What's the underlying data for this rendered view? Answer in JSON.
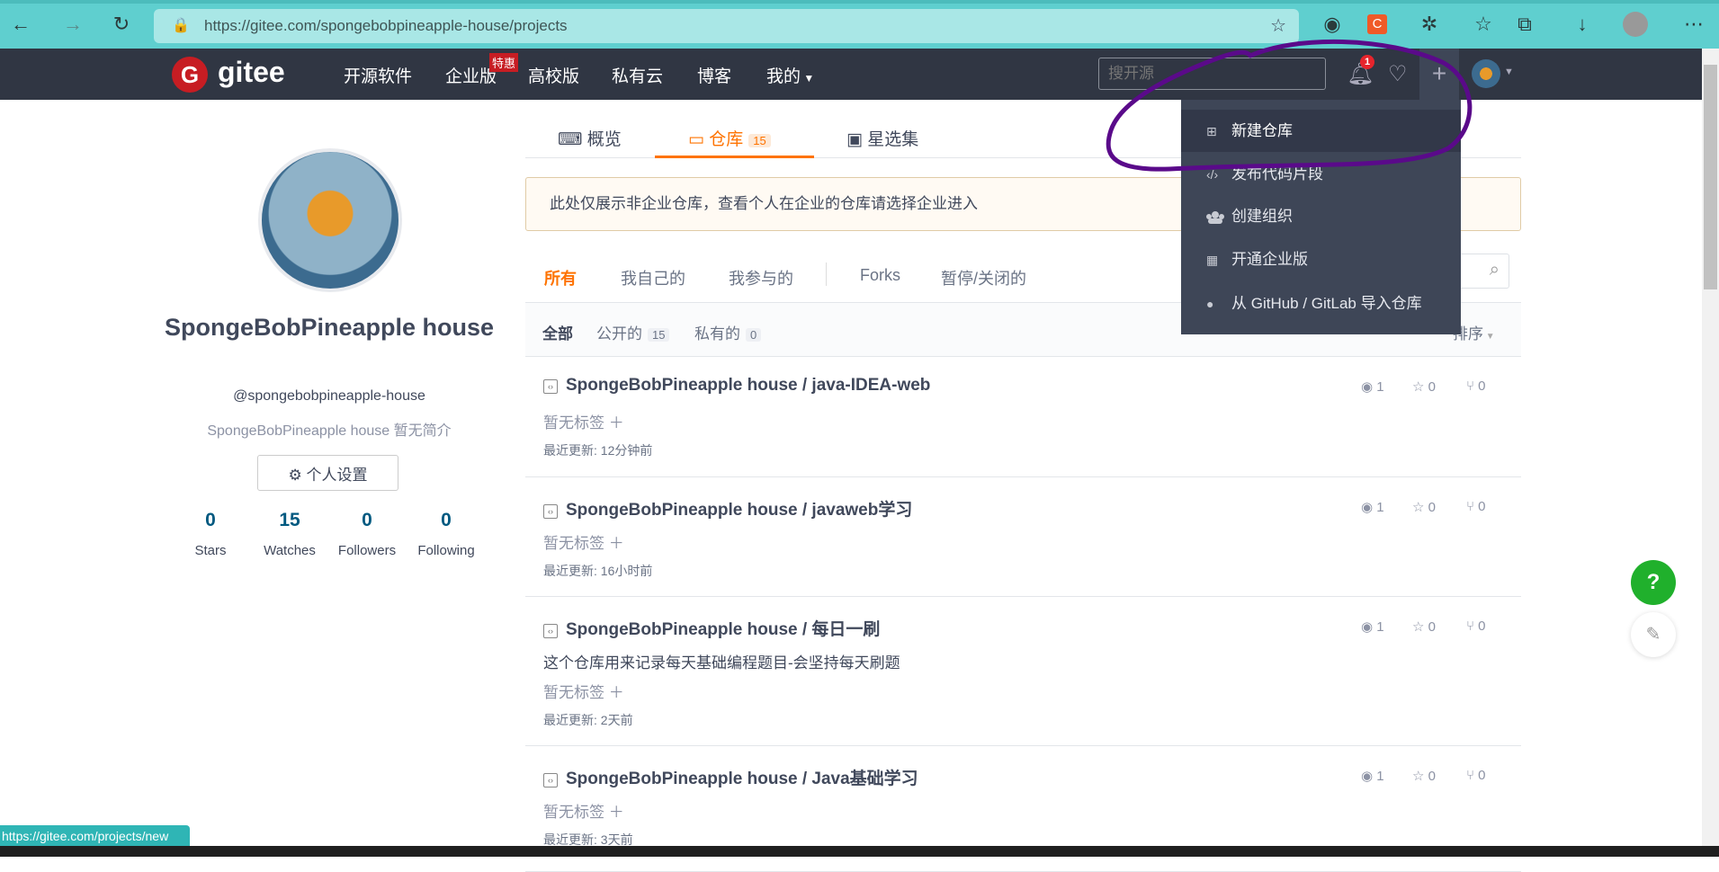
{
  "browser": {
    "url": "https://gitee.com/spongebobpineapple-house/projects",
    "status_link": "https://gitee.com/projects/new"
  },
  "nav": {
    "logo": "gitee",
    "items": [
      "开源软件",
      "企业版",
      "高校版",
      "私有云",
      "博客",
      "我的"
    ],
    "badge": "特惠",
    "search_placeholder": "搜开源",
    "notification_count": "1"
  },
  "dropdown": {
    "items": [
      {
        "label": "新建仓库",
        "icon": "plus-square-icon"
      },
      {
        "label": "发布代码片段",
        "icon": "code-icon"
      },
      {
        "label": "创建组织",
        "icon": "group-icon"
      },
      {
        "label": "开通企业版",
        "icon": "building-icon"
      },
      {
        "label": "从 GitHub / GitLab 导入仓库",
        "icon": "github-icon"
      }
    ]
  },
  "profile": {
    "name": "SpongeBobPineapple house",
    "handle": "@spongebobpineapple-house",
    "bio": "SpongeBobPineapple house 暂无简介",
    "settings": "个人设置",
    "stats": [
      {
        "n": "0",
        "l": "Stars"
      },
      {
        "n": "15",
        "l": "Watches"
      },
      {
        "n": "0",
        "l": "Followers"
      },
      {
        "n": "0",
        "l": "Following"
      }
    ]
  },
  "tabs": [
    {
      "label": "概览"
    },
    {
      "label": "仓库",
      "count": "15"
    },
    {
      "label": "星选集"
    }
  ],
  "notice": "此处仅展示非企业仓库，查看个人在企业的仓库请选择企业进入",
  "filters": [
    "所有",
    "我自己的",
    "我参与的",
    "Forks",
    "暂停/关闭的"
  ],
  "subfilters": [
    {
      "label": "全部"
    },
    {
      "label": "公开的",
      "count": "15"
    },
    {
      "label": "私有的",
      "count": "0"
    }
  ],
  "sort": "排序",
  "repos": [
    {
      "title": "SpongeBobPineapple house / java-IDEA-web",
      "desc": "",
      "tags": "暂无标签 ＋",
      "updated": "最近更新: 12分钟前",
      "watch": "1",
      "star": "0",
      "fork": "0"
    },
    {
      "title": "SpongeBobPineapple house / javaweb学习",
      "desc": "",
      "tags": "暂无标签 ＋",
      "updated": "最近更新: 16小时前",
      "watch": "1",
      "star": "0",
      "fork": "0"
    },
    {
      "title": "SpongeBobPineapple house / 每日一刷",
      "desc": "这个仓库用来记录每天基础编程题目-会坚持每天刷题",
      "tags": "暂无标签 ＋",
      "updated": "最近更新: 2天前",
      "watch": "1",
      "star": "0",
      "fork": "0"
    },
    {
      "title": "SpongeBobPineapple house / Java基础学习",
      "desc": "",
      "tags": "暂无标签 ＋",
      "updated": "最近更新: 3天前",
      "watch": "1",
      "star": "0",
      "fork": "0"
    }
  ],
  "help": "?",
  "colors": {
    "accent": "#fe7300",
    "nav_bg": "#303643",
    "annotation": "#5a0a8a",
    "help": "#20b02c"
  }
}
